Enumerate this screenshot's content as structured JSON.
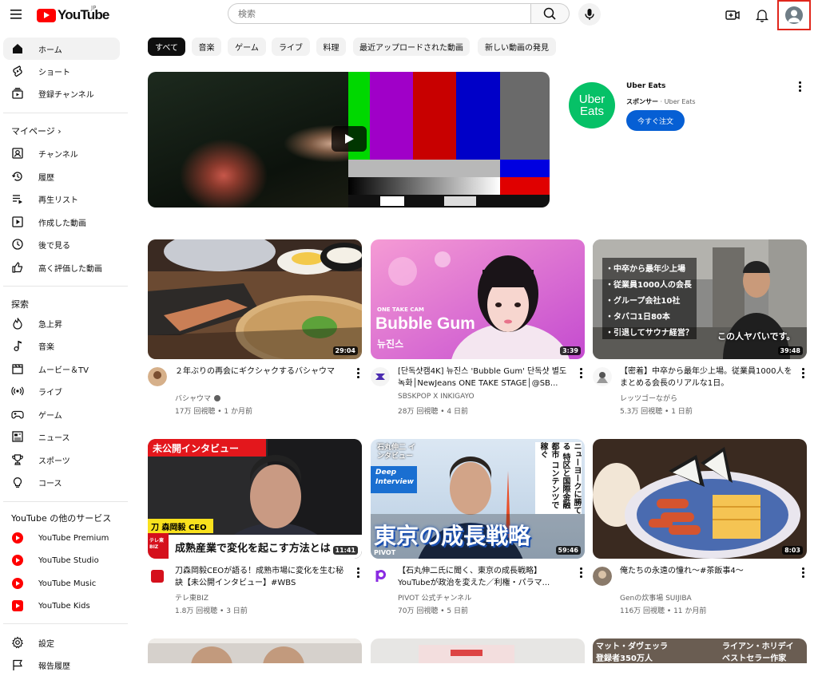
{
  "header": {
    "logo_text": "YouTube",
    "logo_country": "JP",
    "search_placeholder": "検索"
  },
  "sidebar": {
    "main": [
      "ホーム",
      "ショート",
      "登録チャンネル"
    ],
    "my_page_title": "マイページ",
    "my_page_chevron": "›",
    "my_page": [
      "チャンネル",
      "履歴",
      "再生リスト",
      "作成した動画",
      "後で見る",
      "高く評価した動画"
    ],
    "explore_title": "探索",
    "explore": [
      "急上昇",
      "音楽",
      "ムービー＆TV",
      "ライブ",
      "ゲーム",
      "ニュース",
      "スポーツ",
      "コース"
    ],
    "services_title": "YouTube の他のサービス",
    "services": [
      "YouTube Premium",
      "YouTube Studio",
      "YouTube Music",
      "YouTube Kids"
    ],
    "settings": [
      "設定",
      "報告履歴"
    ]
  },
  "chips": [
    "すべて",
    "音楽",
    "ゲーム",
    "ライブ",
    "料理",
    "最近アップロードされた動画",
    "新しい動画の発見"
  ],
  "ad": {
    "logo_line1": "Uber",
    "logo_line2": "Eats",
    "title": "Uber Eats",
    "sponsor_label": "スポンサー",
    "sponsor_name": "Uber Eats",
    "sponsor_sep": " · ",
    "cta": "今すぐ注文"
  },
  "videos": [
    {
      "title": "２年ぶりの再会にギクシャクするバシャウマ",
      "channel": "バシャウマ",
      "verified": true,
      "views": "17万 回視聴",
      "age": "1 か月前",
      "duration": "29:04"
    },
    {
      "title": "[단독샷캠4K] 뉴진스 'Bubble Gum' 단독샷 별도 녹화│NewJeans ONE TAKE STAGE│@SB...",
      "channel": "SBSKPOP X INKIGAYO",
      "verified": false,
      "views": "28万 回視聴",
      "age": "4 日前",
      "duration": "3:39",
      "caption_small": "ONE TAKE CAM",
      "caption_main": "Bubble Gum",
      "caption_sub": "뉴진스"
    },
    {
      "title": "【密着】中卒から最年少上場。従業員1000人をまとめる会長のリアルな1日。",
      "channel": "レッツゴーながら",
      "verified": false,
      "views": "5.3万 回視聴",
      "age": "1 日前",
      "duration": "39:48",
      "bullets": [
        "・中卒から最年少上場",
        "・従業員1000人の会長",
        "・グループ会社10社",
        "・タバコ1日80本",
        "・引退してサウナ経営？"
      ],
      "caption_main": "この人ヤバいです。"
    },
    {
      "title": "刀森岡毅CEOが語る！成熟市場に変化を生む秘訣【未公開インタビュー】#WBS",
      "channel": "テレ東BIZ",
      "verified": false,
      "views": "1.8万 回視聴",
      "age": "3 日前",
      "duration": "11:41",
      "caption_top": "未公開インタビュー",
      "caption_name": "刀 森岡毅 CEO",
      "caption_bottom": "成熟産業で変化を起こす方法とは",
      "caption_logo": "テレ東 BIZ"
    },
    {
      "title": "【石丸伸二氏に聞く、東京の成長戦略】YouTubeが政治を変えた／利権・パラマ...",
      "channel": "PIVOT 公式チャンネル",
      "verified": false,
      "views": "70万 回視聴",
      "age": "5 日前",
      "duration": "59:46",
      "caption_person": "石丸伸二 インタビュー",
      "caption_badge1": "Deep",
      "caption_badge2": "Interview",
      "caption_vertical": "ニューヨークに勝てる 特区と国際金融都市 コンテンツで稼ぐ",
      "caption_main": "東京の成長戦略",
      "caption_brand": "PIVOT"
    },
    {
      "title": "俺たちの永遠の憧れ〜#茶飯事4〜",
      "channel": "Genの炊事場 SUIJIBA",
      "verified": false,
      "views": "116万 回視聴",
      "age": "11 か月前",
      "duration": "8:03"
    }
  ],
  "row3_captions": [
    "マット・ダヴェッラ",
    "登録者350万人",
    "ライアン・ホリデイ",
    "ベストセラー作家"
  ],
  "meta_sep": " • ",
  "colors": {
    "accent_blue": "#065fd4",
    "red": "#ff0000",
    "uber_green": "#06c167",
    "highlight": "#e0261c"
  }
}
